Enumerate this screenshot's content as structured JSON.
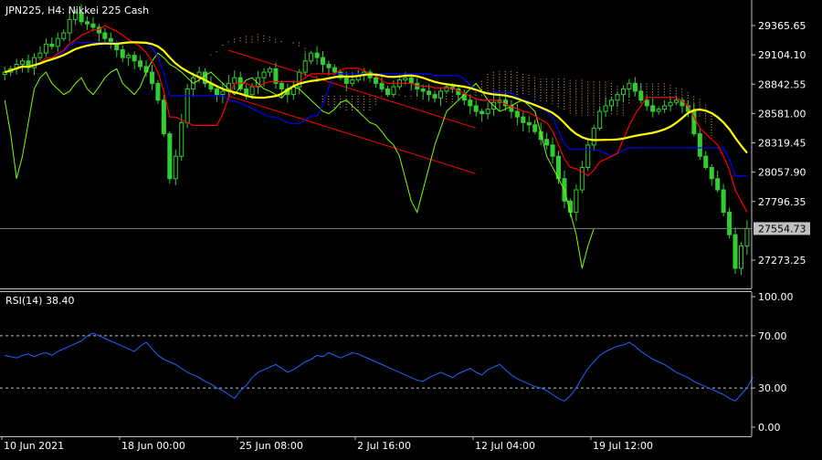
{
  "chart_data": [
    {
      "type": "candlestick",
      "title": "JPN225, H4:  Nikkei 225 Cash",
      "symbol": "JPN225",
      "timeframe": "H4",
      "instrument": "Nikkei 225 Cash",
      "y_ticks": [
        29365.65,
        29104.1,
        28842.55,
        28581.0,
        28319.45,
        28057.9,
        27796.35,
        27273.25
      ],
      "y_tick_labels": [
        "29365.65",
        "29104.10",
        "28842.55",
        "28581.00",
        "28319.45",
        "28057.90",
        "27796.35",
        "27273.25"
      ],
      "current_price": 27554.73,
      "current_price_label": "27554.73",
      "x_tick_labels": [
        "10 Jun 2021",
        "18 Jun 00:00",
        "25 Jun 08:00",
        "2 Jul 16:00",
        "12 Jul 04:00",
        "19 Jul 12:00"
      ],
      "bars_per_tick": 20,
      "close_series": [
        28950,
        28980,
        29020,
        29050,
        28990,
        29080,
        29120,
        29200,
        29180,
        29250,
        29300,
        29420,
        29480,
        29400,
        29380,
        29350,
        29300,
        29250,
        29200,
        29150,
        29080,
        29100,
        29050,
        29000,
        28950,
        28850,
        28700,
        28400,
        28000,
        28200,
        28500,
        28800,
        28900,
        28950,
        28850,
        28800,
        28750,
        28780,
        28850,
        28900,
        28800,
        28750,
        28820,
        28900,
        28950,
        28980,
        28850,
        28800,
        28750,
        28820,
        28950,
        29050,
        29120,
        29080,
        29020,
        28990,
        28950,
        28900,
        28850,
        28880,
        28920,
        28950,
        28900,
        28850,
        28800,
        28750,
        28820,
        28880,
        28900,
        28850,
        28800,
        28780,
        28750,
        28720,
        28780,
        28820,
        28800,
        28750,
        28700,
        28650,
        28600,
        28580,
        28620,
        28680,
        28700,
        28650,
        28600,
        28550,
        28500,
        28480,
        28420,
        28350,
        28300,
        28200,
        28000,
        27800,
        27700,
        27900,
        28100,
        28300,
        28450,
        28600,
        28650,
        28700,
        28750,
        28800,
        28850,
        28780,
        28700,
        28650,
        28600,
        28620,
        28650,
        28680,
        28700,
        28650,
        28600,
        28400,
        28200,
        28100,
        28000,
        27900,
        27700,
        27500,
        27200,
        27400,
        27554.73
      ],
      "indicator_lines": [
        "Ichimoku tenkan-sen (red)",
        "Ichimoku kijun-sen (blue)",
        "Ichimoku chikou span (green)",
        "Moving average (yellow)",
        "Ichimoku cloud (dotted)",
        "Regression channel (red)"
      ]
    },
    {
      "type": "line",
      "indicator": "RSI(14)",
      "label": "RSI(14) 38.40",
      "value": 38.4,
      "ylim": [
        0,
        100
      ],
      "y_tick_labels": [
        "100.00",
        "70.00",
        "30.00",
        "0.00"
      ],
      "levels": [
        70,
        30
      ],
      "values": [
        55,
        54,
        53,
        55,
        56,
        54,
        56,
        57,
        55,
        58,
        60,
        62,
        64,
        66,
        70,
        72,
        70,
        68,
        66,
        64,
        62,
        60,
        58,
        62,
        65,
        60,
        55,
        52,
        50,
        48,
        45,
        42,
        40,
        38,
        35,
        33,
        30,
        28,
        25,
        22,
        28,
        32,
        38,
        42,
        44,
        46,
        48,
        45,
        42,
        44,
        47,
        50,
        52,
        55,
        54,
        57,
        55,
        53,
        55,
        57,
        56,
        54,
        52,
        50,
        48,
        46,
        44,
        42,
        40,
        38,
        36,
        35,
        38,
        40,
        42,
        40,
        38,
        41,
        43,
        45,
        42,
        40,
        44,
        46,
        48,
        44,
        40,
        37,
        35,
        33,
        31,
        30,
        28,
        25,
        22,
        20,
        24,
        30,
        38,
        45,
        50,
        55,
        58,
        60,
        62,
        63,
        65,
        62,
        58,
        55,
        52,
        50,
        48,
        45,
        42,
        40,
        38,
        35,
        33,
        31,
        29,
        27,
        25,
        22,
        20,
        25,
        30,
        38.4
      ],
      "line_color": "#1e66ff"
    }
  ],
  "colors": {
    "background": "#000000",
    "bull_candle": "#32cd32",
    "bear_candle": "#32cd32",
    "tenkan": "#ff0000",
    "kijun": "#0000ff",
    "chikou": "#7fff00",
    "moving_average": "#ffff00",
    "cloud": "#f4a460",
    "axis_text": "#ffffff",
    "price_box": "#c0c0c0"
  }
}
